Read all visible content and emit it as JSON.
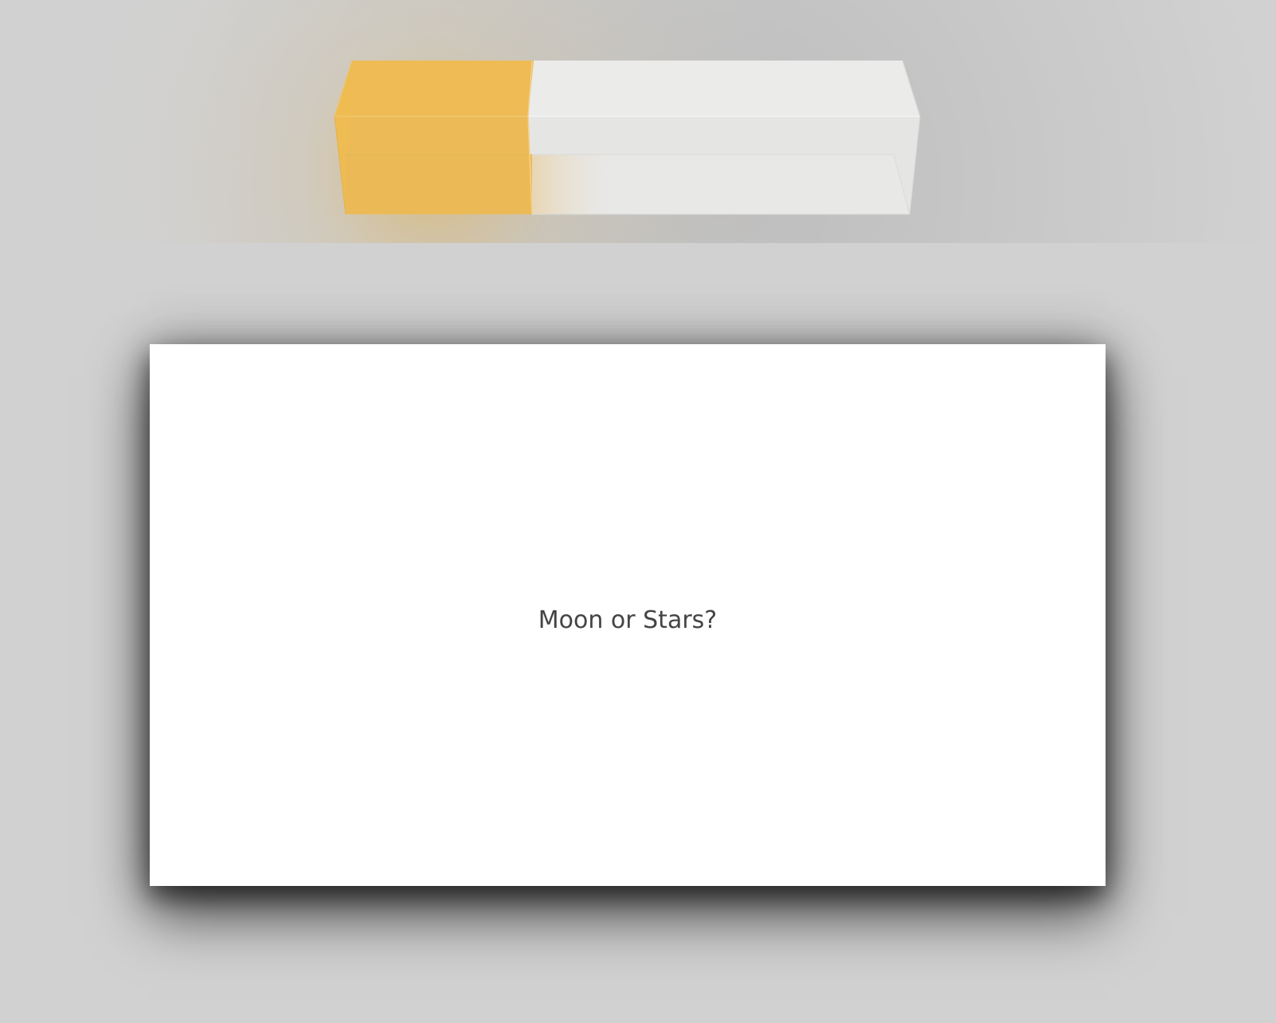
{
  "progress": {
    "value": 0.35,
    "fill_color": "#edb850",
    "track_color": "#e6e6e5"
  },
  "card": {
    "text": "Moon or Stars?"
  }
}
